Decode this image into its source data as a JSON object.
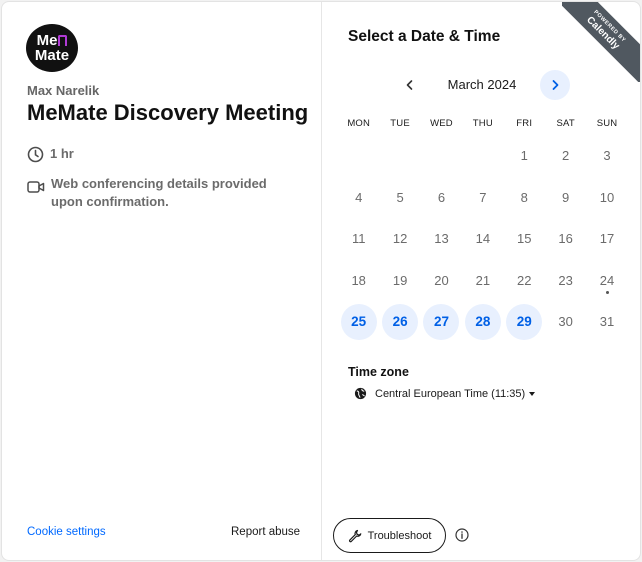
{
  "organizer": {
    "logo_line1": "Me",
    "logo_line2": "Mate",
    "name": "Max Narelik"
  },
  "event": {
    "title": "MeMate Discovery Meeting",
    "duration": "1 hr",
    "conferencing": "Web conferencing details provided upon confirmation."
  },
  "footer": {
    "cookie_settings": "Cookie settings",
    "report_abuse": "Report abuse"
  },
  "scheduler": {
    "title": "Select a Date & Time",
    "month": "March 2024",
    "weekdays": [
      "MON",
      "TUE",
      "WED",
      "THU",
      "FRI",
      "SAT",
      "SUN"
    ],
    "days": [
      {
        "label": "",
        "available": false
      },
      {
        "label": "",
        "available": false
      },
      {
        "label": "",
        "available": false
      },
      {
        "label": "",
        "available": false
      },
      {
        "label": "1",
        "available": false
      },
      {
        "label": "2",
        "available": false
      },
      {
        "label": "3",
        "available": false
      },
      {
        "label": "4",
        "available": false
      },
      {
        "label": "5",
        "available": false
      },
      {
        "label": "6",
        "available": false
      },
      {
        "label": "7",
        "available": false
      },
      {
        "label": "8",
        "available": false
      },
      {
        "label": "9",
        "available": false
      },
      {
        "label": "10",
        "available": false
      },
      {
        "label": "11",
        "available": false
      },
      {
        "label": "12",
        "available": false
      },
      {
        "label": "13",
        "available": false
      },
      {
        "label": "14",
        "available": false
      },
      {
        "label": "15",
        "available": false
      },
      {
        "label": "16",
        "available": false
      },
      {
        "label": "17",
        "available": false
      },
      {
        "label": "18",
        "available": false
      },
      {
        "label": "19",
        "available": false
      },
      {
        "label": "20",
        "available": false
      },
      {
        "label": "21",
        "available": false
      },
      {
        "label": "22",
        "available": false
      },
      {
        "label": "23",
        "available": false
      },
      {
        "label": "24",
        "available": false,
        "today": true
      },
      {
        "label": "25",
        "available": true
      },
      {
        "label": "26",
        "available": true
      },
      {
        "label": "27",
        "available": true
      },
      {
        "label": "28",
        "available": true
      },
      {
        "label": "29",
        "available": true
      },
      {
        "label": "30",
        "available": false
      },
      {
        "label": "31",
        "available": false
      }
    ],
    "timezone_label": "Time zone",
    "timezone_value": "Central European Time (11:35)",
    "troubleshoot": "Troubleshoot"
  },
  "badge": {
    "powered_by": "POWERED BY",
    "brand": "Calendly"
  },
  "colors": {
    "accent": "#0069ff",
    "available_bg": "#e8f0fe",
    "available_text": "#0060e6",
    "ribbon": "#505860"
  },
  "icons": [
    "clock-icon",
    "video-icon",
    "chevron-left-icon",
    "chevron-right-icon",
    "globe-icon",
    "caret-down-icon",
    "wrench-icon",
    "info-icon"
  ]
}
